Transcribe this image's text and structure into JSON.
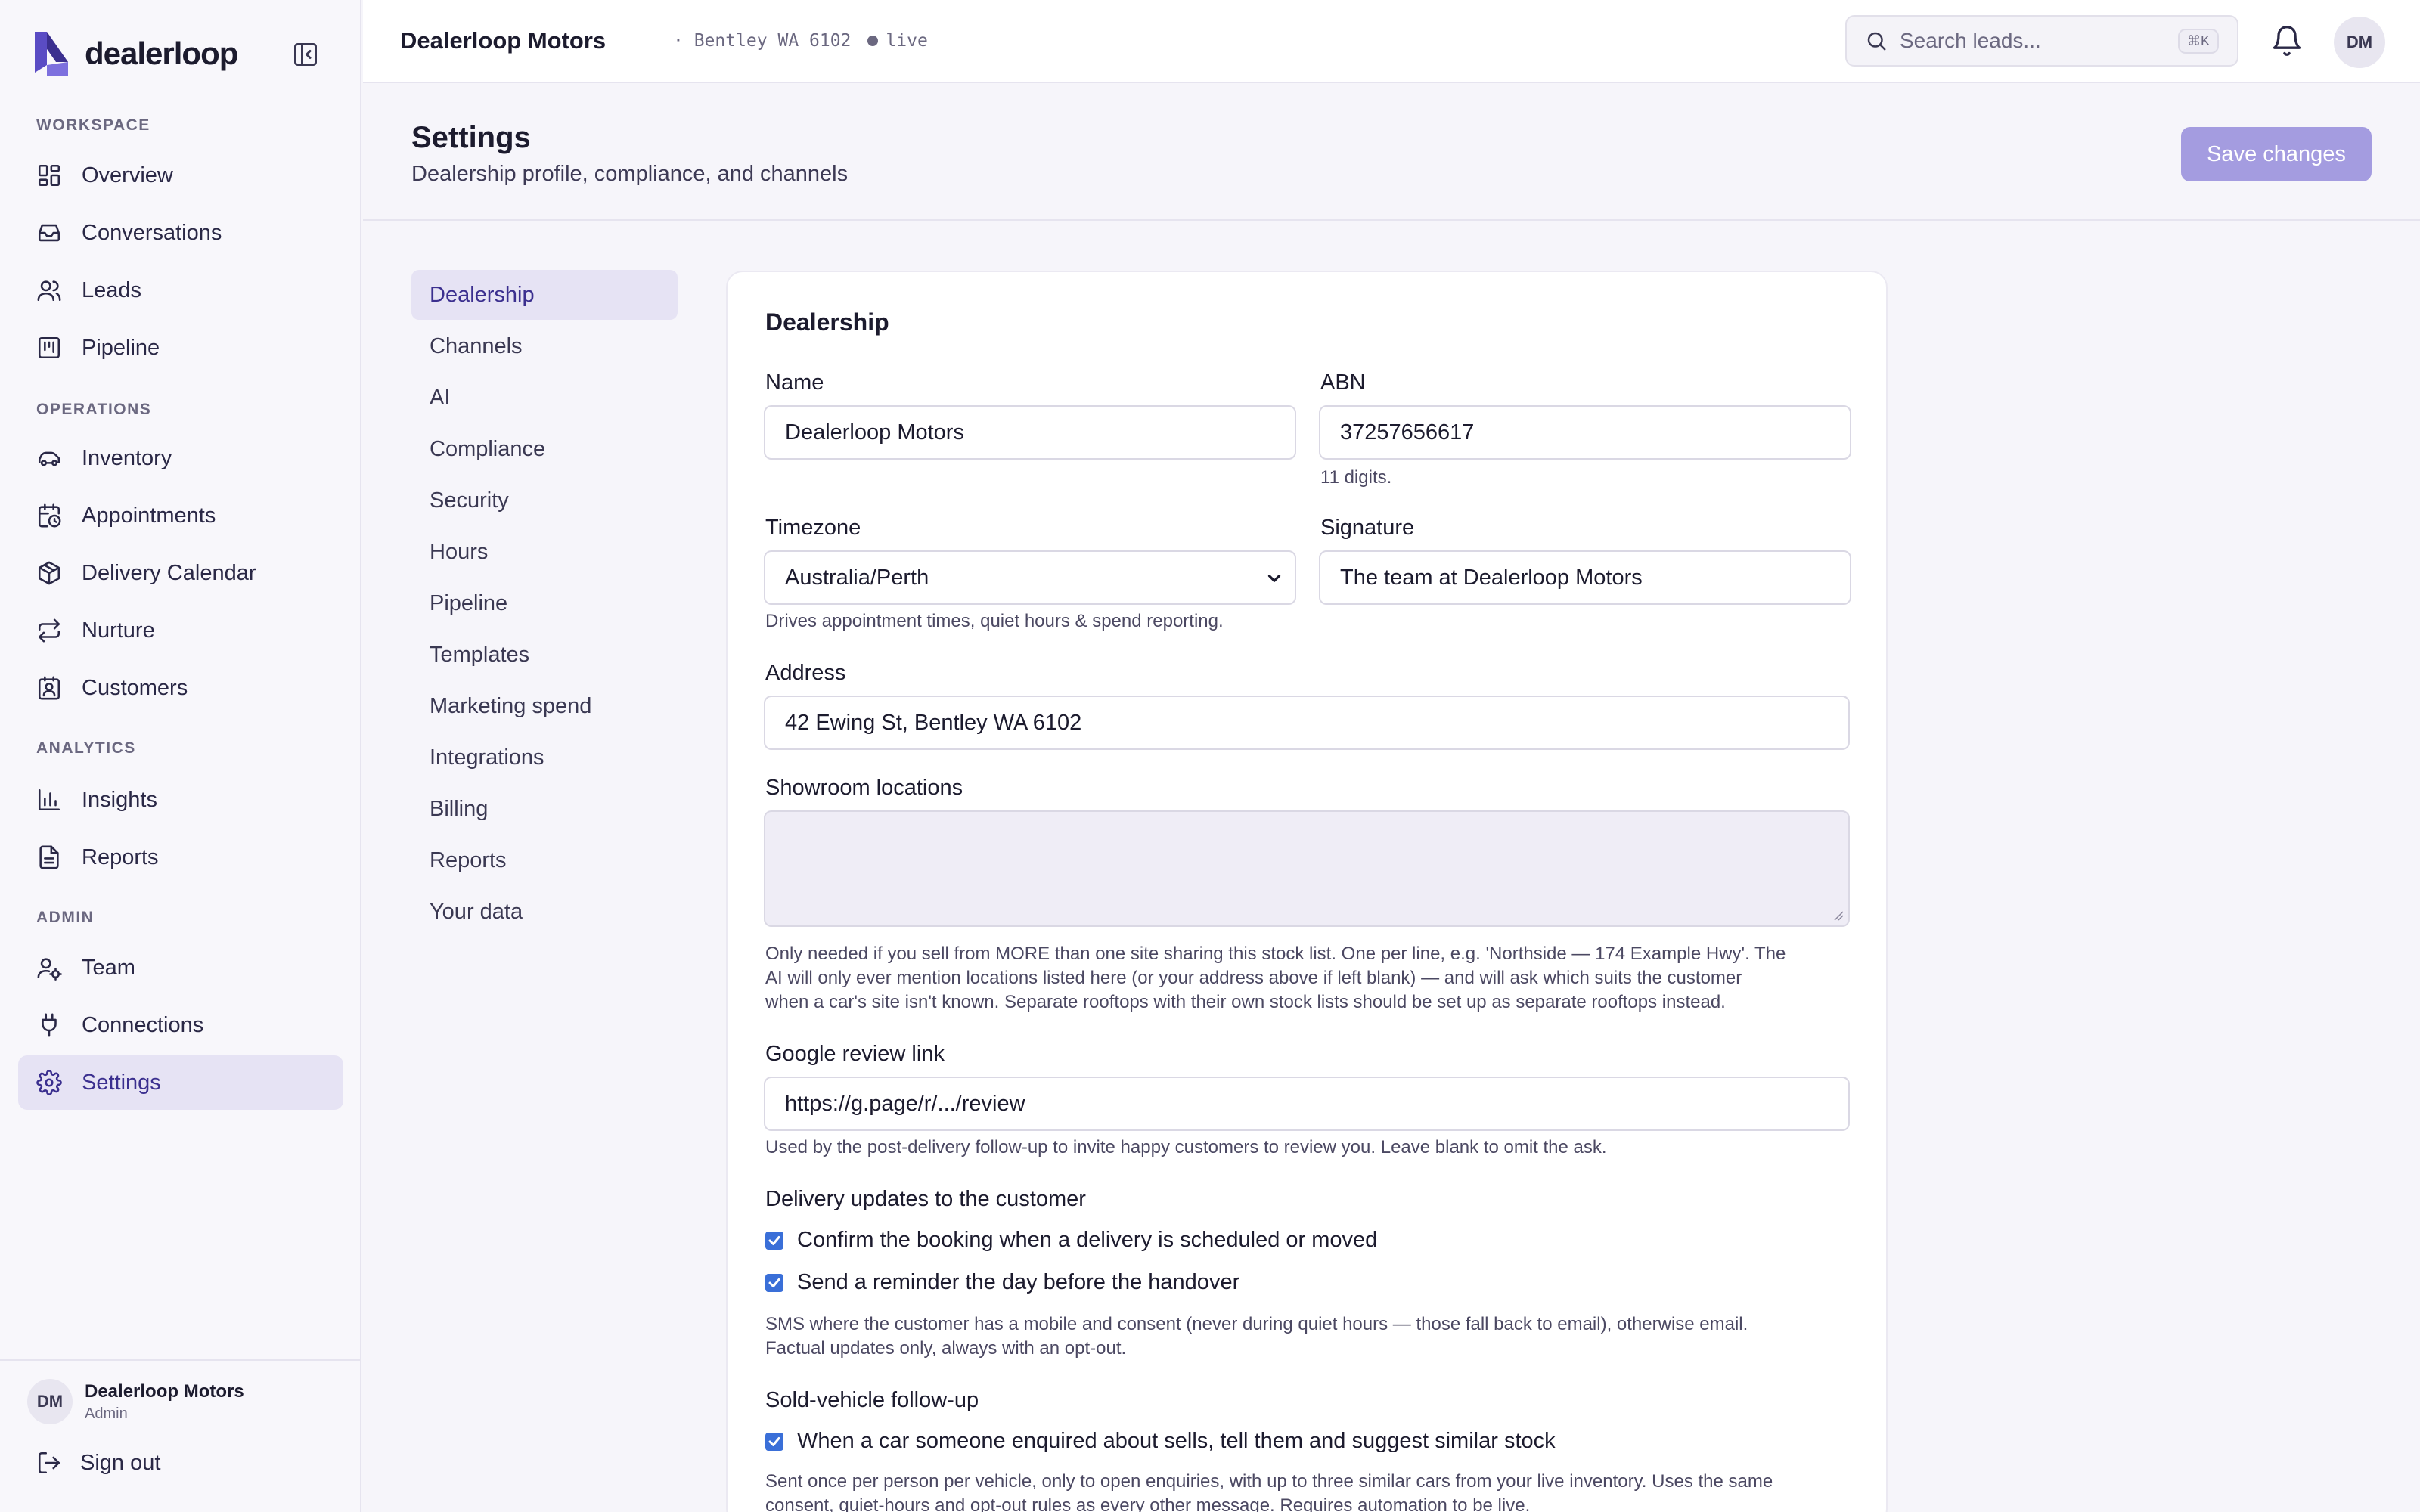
{
  "brand": {
    "name": "dealerloop",
    "color": "#3b2f8f"
  },
  "sidebar": {
    "sections": [
      {
        "label": "WORKSPACE"
      },
      {
        "label": "OPERATIONS"
      },
      {
        "label": "ANALYTICS"
      },
      {
        "label": "ADMIN"
      }
    ],
    "items": [
      {
        "label": "Overview",
        "icon": "grid-icon"
      },
      {
        "label": "Conversations",
        "icon": "inbox-icon"
      },
      {
        "label": "Leads",
        "icon": "users-icon"
      },
      {
        "label": "Pipeline",
        "icon": "kanban-icon"
      },
      {
        "label": "Inventory",
        "icon": "car-icon"
      },
      {
        "label": "Appointments",
        "icon": "calendar-clock-icon"
      },
      {
        "label": "Delivery Calendar",
        "icon": "package-icon"
      },
      {
        "label": "Nurture",
        "icon": "repeat-icon"
      },
      {
        "label": "Customers",
        "icon": "contact-icon"
      },
      {
        "label": "Insights",
        "icon": "bar-chart-icon"
      },
      {
        "label": "Reports",
        "icon": "file-text-icon"
      },
      {
        "label": "Team",
        "icon": "user-cog-icon"
      },
      {
        "label": "Connections",
        "icon": "plug-icon"
      },
      {
        "label": "Settings",
        "icon": "gear-icon",
        "active": true
      }
    ],
    "footer": {
      "initials": "DM",
      "name": "Dealerloop Motors",
      "role": "Admin",
      "signout": "Sign out"
    }
  },
  "topbar": {
    "title": "Dealerloop Motors",
    "location": "· Bentley WA 6102",
    "status": "live",
    "search_placeholder": "Search leads...",
    "shortcut": "⌘K",
    "avatar": "DM"
  },
  "header": {
    "title": "Settings",
    "subtitle": "Dealership profile, compliance, and channels",
    "save_label": "Save changes",
    "save_color": "#a49ce0"
  },
  "subnav": {
    "items": [
      {
        "label": "Dealership",
        "active": true
      },
      {
        "label": "Channels"
      },
      {
        "label": "AI"
      },
      {
        "label": "Compliance"
      },
      {
        "label": "Security"
      },
      {
        "label": "Hours"
      },
      {
        "label": "Pipeline"
      },
      {
        "label": "Templates"
      },
      {
        "label": "Marketing spend"
      },
      {
        "label": "Integrations"
      },
      {
        "label": "Billing"
      },
      {
        "label": "Reports"
      },
      {
        "label": "Your data"
      }
    ]
  },
  "form": {
    "title": "Dealership",
    "name": {
      "label": "Name",
      "value": "Dealerloop Motors"
    },
    "abn": {
      "label": "ABN",
      "value": "37257656617",
      "help": "11 digits."
    },
    "timezone": {
      "label": "Timezone",
      "value": "Australia/Perth",
      "help": "Drives appointment times, quiet hours & spend reporting."
    },
    "signature": {
      "label": "Signature",
      "value": "The team at Dealerloop Motors"
    },
    "address": {
      "label": "Address",
      "value": "42 Ewing St, Bentley WA 6102"
    },
    "showroom": {
      "label": "Showroom locations",
      "value": "",
      "help_lines": [
        "Only needed if you sell from MORE than one site sharing this stock list. One per line, e.g. 'Northside — 174 Example Hwy'. The",
        "AI will only ever mention locations listed here (or your address above if left blank) — and will ask which suits the customer",
        "when a car's site isn't known. Separate rooftops with their own stock lists should be set up as separate rooftops instead."
      ]
    },
    "review": {
      "label": "Google review link",
      "value": "https://g.page/r/.../review",
      "help": "Used by the post-delivery follow-up to invite happy customers to review you. Leave blank to omit the ask."
    },
    "delivery": {
      "heading": "Delivery updates to the customer",
      "options": [
        {
          "label": "Confirm the booking when a delivery is scheduled or moved",
          "checked": true
        },
        {
          "label": "Send a reminder the day before the handover",
          "checked": true
        }
      ],
      "help_lines": [
        "SMS where the customer has a mobile and consent (never during quiet hours — those fall back to email), otherwise email.",
        "Factual updates only, always with an opt-out."
      ]
    },
    "sold": {
      "heading": "Sold-vehicle follow-up",
      "options": [
        {
          "label": "When a car someone enquired about sells, tell them and suggest similar stock",
          "checked": true
        }
      ],
      "help_lines": [
        "Sent once per person per vehicle, only to open enquiries, with up to three similar cars from your live inventory. Uses the same",
        "consent, quiet-hours and opt-out rules as every other message. Requires automation to be live."
      ]
    },
    "checkbox_color": "#3a6fd8"
  }
}
